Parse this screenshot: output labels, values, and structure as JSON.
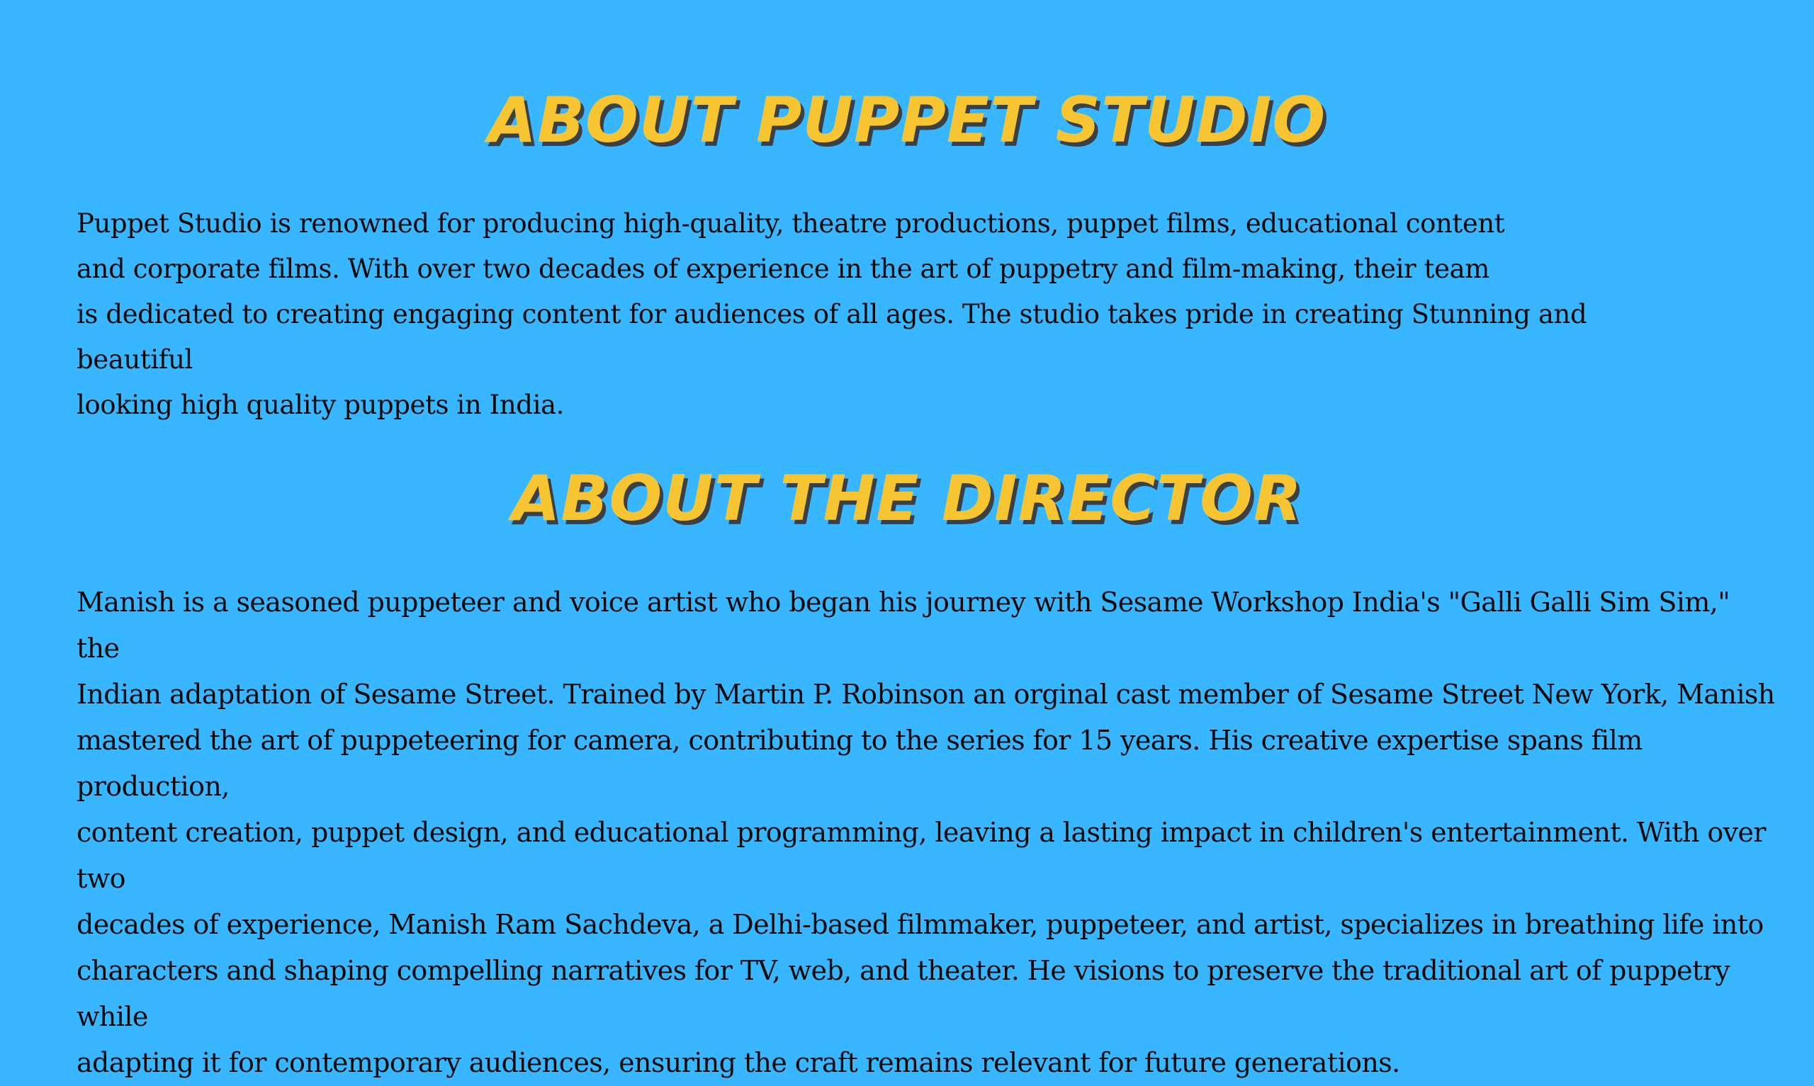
{
  "about_studio": {
    "heading": "ABOUT PUPPET STUDIO",
    "body": "Puppet Studio is renowned for producing high-quality, theatre productions, puppet films, educational content\nand corporate films. With over two decades of experience in the art of puppetry and film-making, their team\nis dedicated to creating engaging content for audiences of all ages. The studio takes pride in creating Stunning and beautiful\nlooking high quality puppets in India."
  },
  "about_director": {
    "heading": "ABOUT THE DIRECTOR",
    "body": "Manish is a seasoned puppeteer and voice artist who began his journey with Sesame Workshop India's \"Galli Galli Sim Sim,\" the\nIndian adaptation of Sesame Street. Trained by Martin P. Robinson an orginal cast member of Sesame Street New York, Manish\nmastered the art of puppeteering for camera, contributing to the series for 15 years. His creative expertise spans film production,\ncontent creation, puppet design, and educational programming, leaving a lasting impact in children's entertainment. With over two\ndecades of experience, Manish Ram Sachdeva, a Delhi-based filmmaker, puppeteer, and artist, specializes in breathing life into\ncharacters and shaping compelling narratives for TV, web, and theater. He visions to preserve the traditional art of puppetry while\nadapting it for contemporary audiences, ensuring the craft remains relevant for future generations."
  },
  "colors": {
    "background": "#38b6ff",
    "heading": "#f7c531",
    "heading_shadow": "#3a4046",
    "text": "#0a0a0a"
  }
}
